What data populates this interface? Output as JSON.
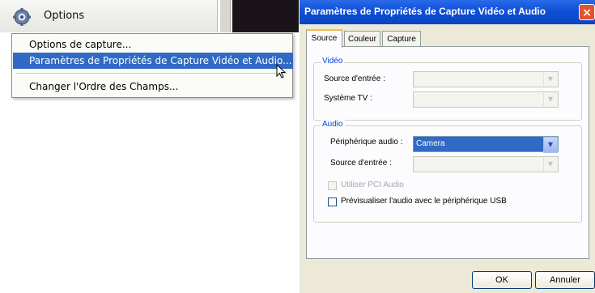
{
  "toolbar": {
    "options_label": "Options"
  },
  "context_menu": {
    "items": [
      {
        "label": "Options de capture..."
      },
      {
        "label": "Paramètres de Propriétés de Capture Vidéo et Audio..."
      },
      {
        "label": "Changer l'Ordre des Champs..."
      }
    ]
  },
  "dialog": {
    "title": "Paramètres de Propriétés de Capture Vidéo et Audio",
    "close_icon": "×",
    "tabs": [
      {
        "label": "Source"
      },
      {
        "label": "Couleur"
      },
      {
        "label": "Capture"
      }
    ],
    "video_group": {
      "legend": "Vidéo",
      "input_source_label": "Source d'entrée :",
      "input_source_value": "",
      "tv_system_label": "Système TV :",
      "tv_system_value": ""
    },
    "audio_group": {
      "legend": "Audio",
      "device_label": "Périphérique audio :",
      "device_value": "Camera",
      "input_source_label": "Source d'entrée :",
      "input_source_value": "",
      "pci_audio_label": "Utiliser PCI Audio",
      "preview_usb_label": "Prévisualiser l'audio avec le périphérique USB"
    },
    "ok_label": "OK",
    "cancel_label": "Annuler"
  },
  "colors": {
    "menu_selection": "#316ac5",
    "titlebar": "#0f4fd6",
    "group_legend": "#0046d5"
  },
  "icons": [
    "gear-icon",
    "mouse-cursor-icon",
    "close-icon",
    "combo-arrow-icon"
  ]
}
